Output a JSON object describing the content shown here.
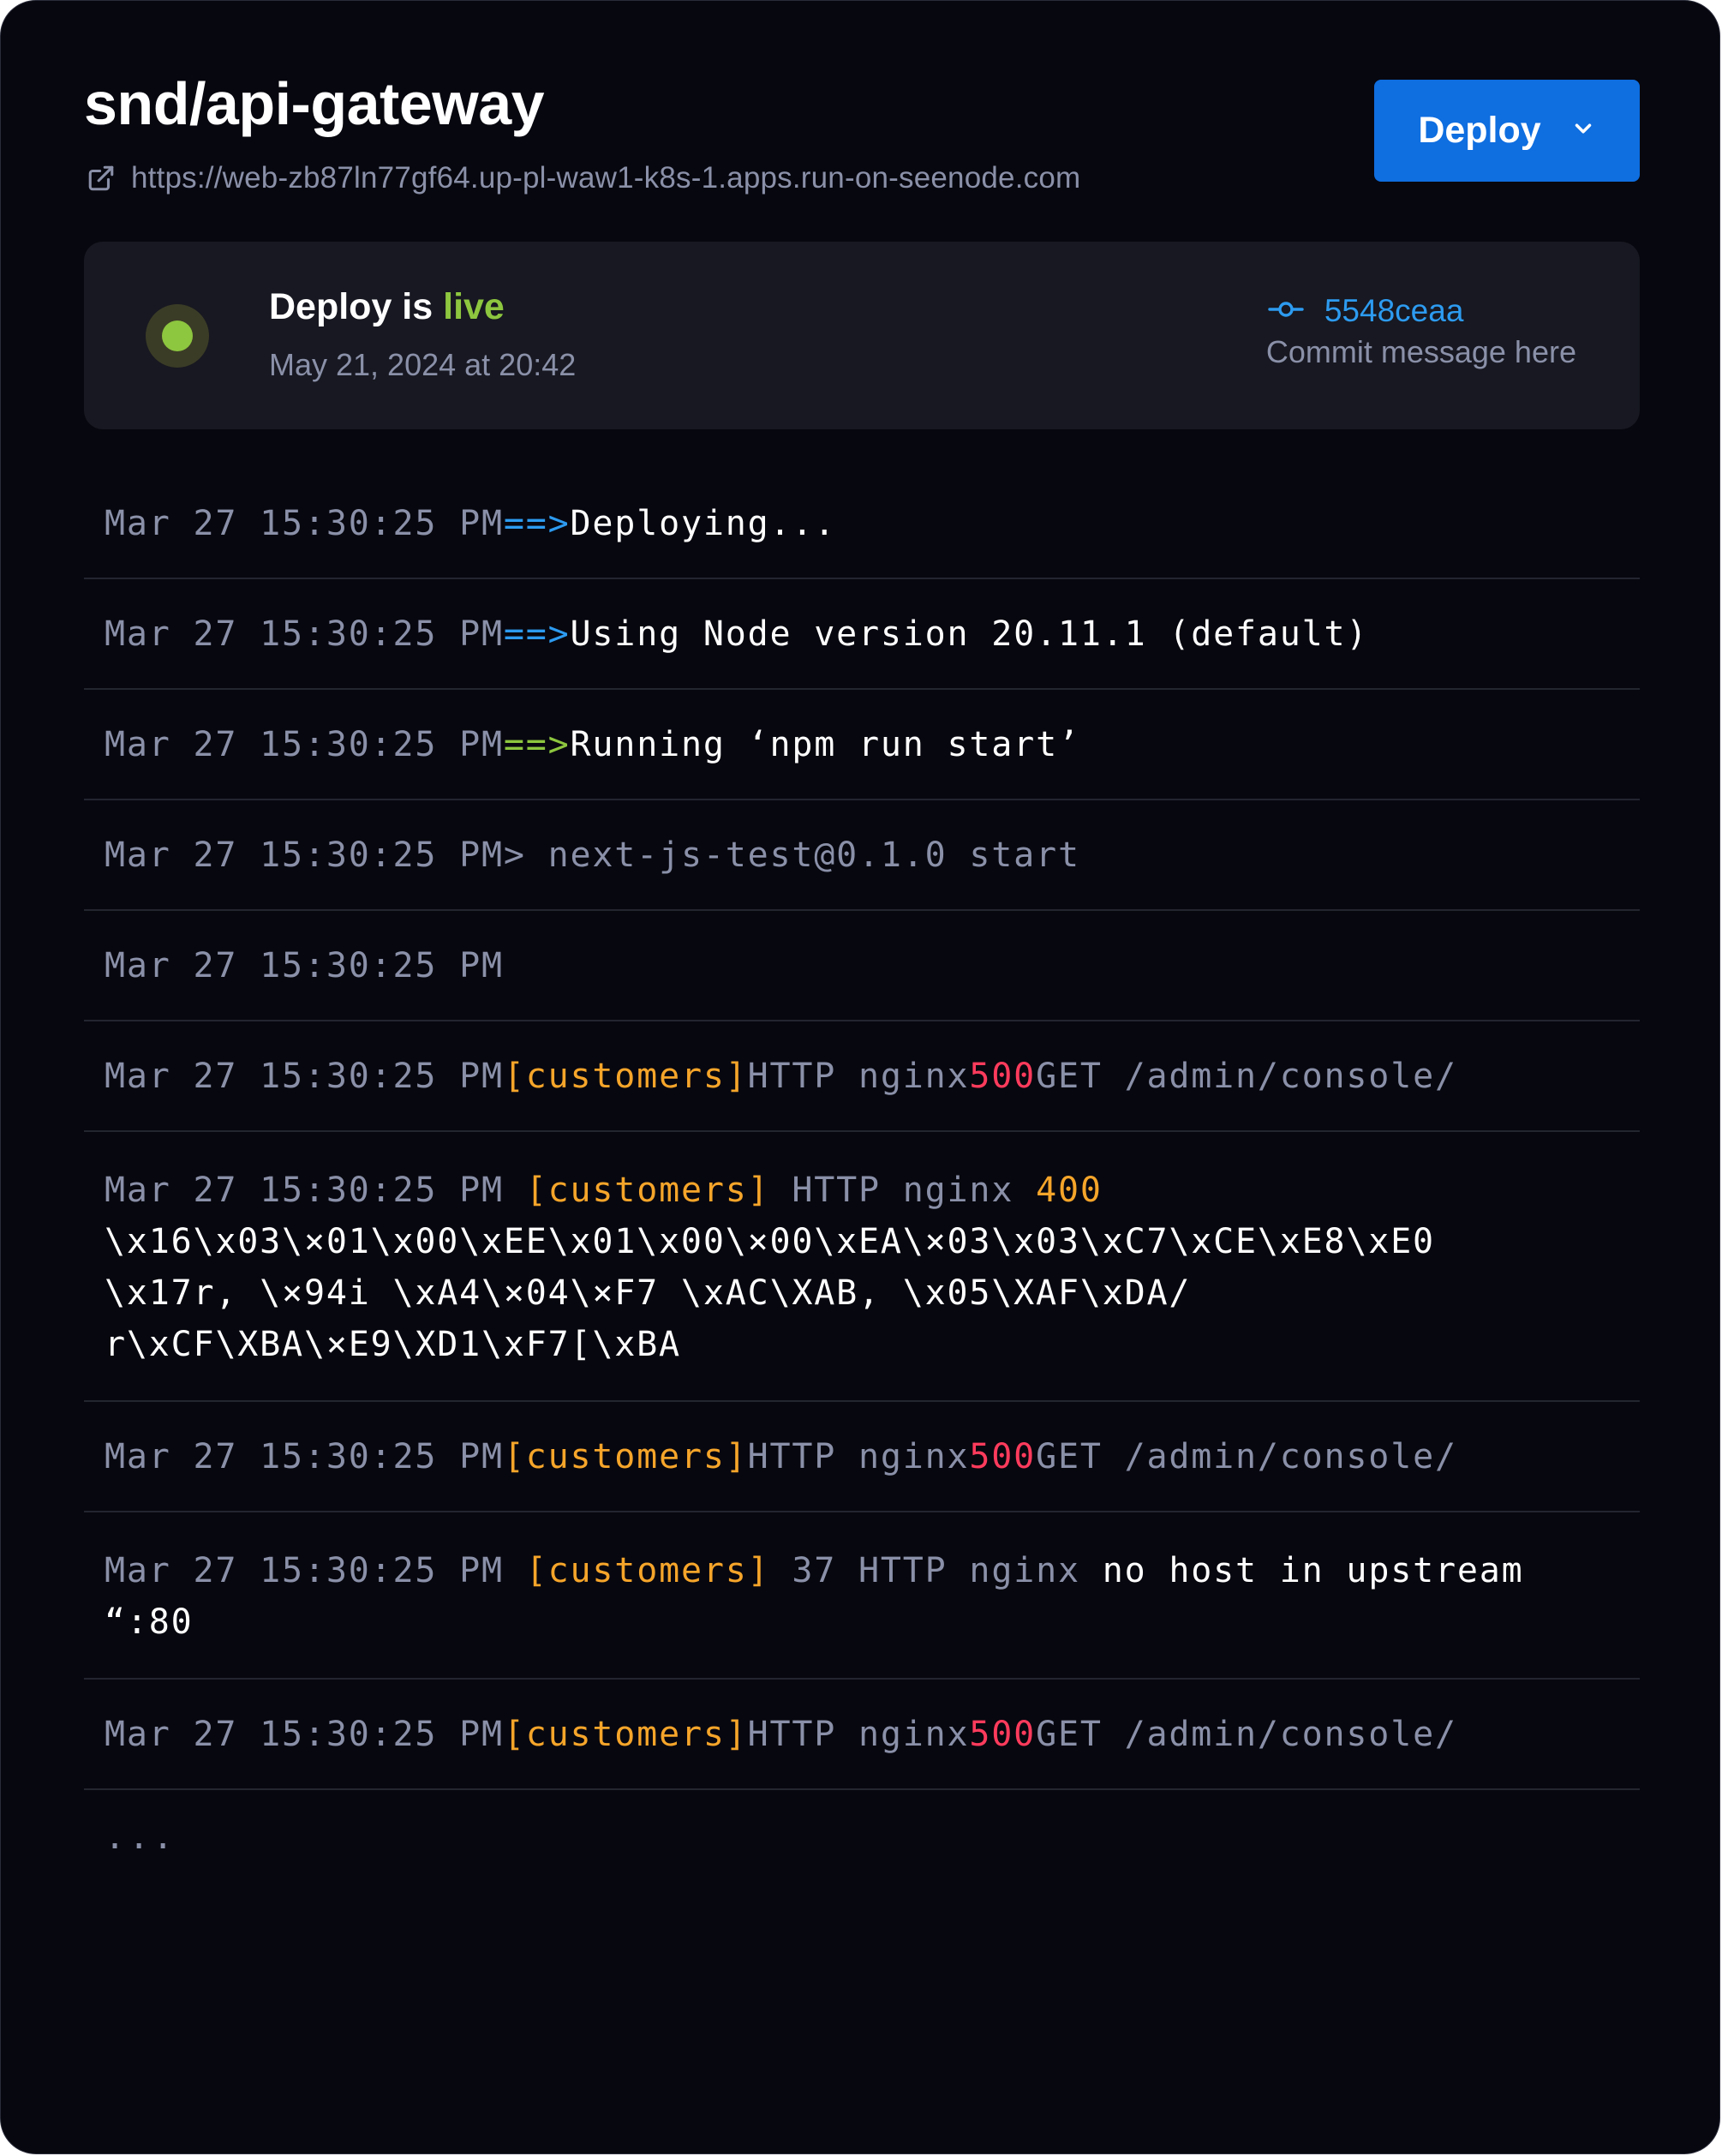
{
  "header": {
    "title": "snd/api-gateway",
    "url": "https://web-zb87ln77gf64.up-pl-waw1-k8s-1.apps.run-on-seenode.com",
    "url_icon": "external-link-icon",
    "deploy_button": {
      "label": "Deploy",
      "icon": "chevron-down-icon"
    }
  },
  "status": {
    "prefix": "Deploy is ",
    "state": "live",
    "date": "May 21, 2024 at 20:42",
    "commit_icon": "git-commit-icon",
    "commit_hash": "5548ceaa",
    "commit_message": "Commit message here"
  },
  "colors": {
    "background": "#07070f",
    "card": "#171821",
    "accent_blue": "#0f6ee0",
    "link_blue": "#2d9bf0",
    "live_green": "#8dc63f",
    "tag_orange": "#f5a52a",
    "error_red": "#ff3b5c",
    "muted": "#8a90a8"
  },
  "logs": [
    {
      "timestamp": "Mar 27 15:30:25 PM",
      "arrow": "==>",
      "arrow_color": "blue",
      "message": "Deploying..."
    },
    {
      "timestamp": "Mar 27 15:30:25 PM",
      "arrow": "==>",
      "arrow_color": "blue",
      "message": "Using Node version 20.11.1 (default)"
    },
    {
      "timestamp": "Mar 27 15:30:25 PM",
      "arrow": "==>",
      "arrow_color": "green",
      "message": "Running ‘npm run start’"
    },
    {
      "timestamp": "Mar 27 15:30:25 PM",
      "text": "> next-js-test@0.1.0 start"
    },
    {
      "timestamp": "Mar 27 15:30:25 PM"
    },
    {
      "timestamp": "Mar 27 15:30:25 PM",
      "tag": "[customers]",
      "proto": "HTTP nginx",
      "code": "500",
      "code_color": "red",
      "rest": "GET /admin/console/"
    },
    {
      "timestamp": "Mar 27 15:30:25 PM",
      "tag": "[customers]",
      "proto": "HTTP nginx",
      "code": "400",
      "code_color": "orange",
      "continuation": [
        "\\x16\\x03\\×01\\x00\\xEE\\x01\\x00\\×00\\xEA\\×03\\x03\\xC7\\xCE\\xE8\\xE0",
        "\\x17r, \\×94i \\xA4\\×04\\×F7 \\xAC\\XAB, \\x05\\XAF\\xDA/",
        "r\\xCF\\XBA\\×E9\\XD1\\xF7[\\xBA"
      ]
    },
    {
      "timestamp": "Mar 27 15:30:25 PM",
      "tag": "[customers]",
      "proto": "HTTP nginx",
      "code": "500",
      "code_color": "red",
      "rest": "GET /admin/console/"
    },
    {
      "timestamp": "Mar 27 15:30:25 PM",
      "tag": "[customers]",
      "proto": "37 HTTP nginx",
      "message": "no host in upstream",
      "continuation": [
        "“:80"
      ]
    },
    {
      "timestamp": "Mar 27 15:30:25 PM",
      "tag": "[customers]",
      "proto": "HTTP nginx",
      "code": "500",
      "code_color": "red",
      "rest": "GET /admin/console/"
    }
  ],
  "more": "..."
}
